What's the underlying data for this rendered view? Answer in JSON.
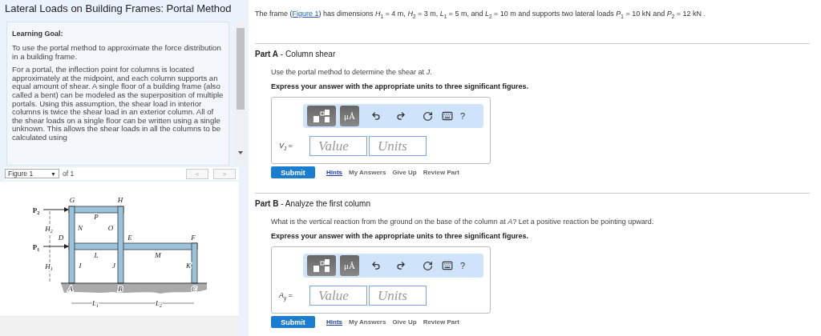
{
  "left_panel": {
    "title": "Lateral Loads on Building Frames: Portal Method",
    "learning_goal": {
      "heading": "Learning Goal:",
      "paragraphs": [
        "To use the portal method to approximate the force distribution in a building frame.",
        "For a portal, the inflection point for columns is located approximately at the midpoint, and each column supports an equal amount of shear. A single floor of a building frame (also called a bent) can be modeled as the superposition of multiple portals. Using this assumption, the shear load in interior columns is twice the shear load in an exterior column. All of the shear loads on a single floor can be written using a single unknown. This allows the shear loads in all the columns to be calculated using"
      ]
    },
    "figure_nav": {
      "select": "Figure 1",
      "caret": "▼",
      "count": "of 1",
      "prev": "<",
      "next": ">"
    },
    "figure": {
      "labels": [
        {
          "main": "G",
          "kind": "point"
        },
        {
          "main": "H",
          "kind": "point"
        },
        {
          "main": "P",
          "sub": "2",
          "kind": "load"
        },
        {
          "main": "P",
          "kind": "point"
        },
        {
          "main": "H",
          "sub": "2",
          "kind": "point"
        },
        {
          "main": "N",
          "kind": "point"
        },
        {
          "main": "O",
          "kind": "point"
        },
        {
          "main": "D",
          "kind": "point"
        },
        {
          "main": "E",
          "kind": "point"
        },
        {
          "main": "F",
          "kind": "point"
        },
        {
          "main": "P",
          "sub": "1",
          "kind": "load"
        },
        {
          "main": "L",
          "kind": "point"
        },
        {
          "main": "M",
          "kind": "point"
        },
        {
          "main": "H",
          "sub": "1",
          "kind": "point"
        },
        {
          "main": "I",
          "kind": "point"
        },
        {
          "main": "J",
          "kind": "point"
        },
        {
          "main": "K",
          "kind": "point"
        },
        {
          "main": "A",
          "kind": "point"
        },
        {
          "main": "B",
          "kind": "point"
        },
        {
          "main": "C",
          "kind": "point"
        },
        {
          "main": "L",
          "sub": "1",
          "kind": "point"
        },
        {
          "main": "L",
          "sub": "2",
          "kind": "point"
        }
      ]
    }
  },
  "intro": {
    "before": "The frame (",
    "link": "Figure 1",
    "after": ") has dimensions *H*$_{1}$ = 4 m, *H*$_{2}$ = 3 m, *L*$_{1}$ = 5 m, and *L*$_{2}$ = 10 m and supports two lateral loads *P*$_{1}$ = 10 kN and *P*$_{2}$ = 12 kN ."
  },
  "parts": [
    {
      "header": "**Part A** - Column shear",
      "question": "Use the portal method to determine the shear at *J*.",
      "instruction": "Express your answer with the appropriate units to three significant figures.",
      "toolbar": {
        "units": "μÅ",
        "help": "?"
      },
      "answer_label": "*V*$_{J}$ =",
      "value_placeholder": "Value",
      "units_placeholder": "Units",
      "submit": "Submit",
      "links": [
        {
          "label": "Hints",
          "kind": "link"
        },
        {
          "label": "My Answers",
          "kind": "action"
        },
        {
          "label": "Give Up",
          "kind": "action"
        },
        {
          "label": "Review Part",
          "kind": "action"
        }
      ]
    },
    {
      "header": "**Part B** - Analyze the first column",
      "question": "What is the vertical reaction from the ground on the base of the column at *A*? Let a positive reaction be pointing upward.",
      "instruction": "Express your answer with the appropriate units to three significant figures.",
      "toolbar": {
        "units": "μÅ",
        "help": "?"
      },
      "answer_label": "*A*$_{y}$ =",
      "value_placeholder": "Value",
      "units_placeholder": "Units",
      "submit": "Submit",
      "links": [
        {
          "label": "Hints",
          "kind": "link"
        },
        {
          "label": "My Answers",
          "kind": "action"
        },
        {
          "label": "Give Up",
          "kind": "action"
        },
        {
          "label": "Review Part",
          "kind": "action"
        }
      ]
    }
  ]
}
